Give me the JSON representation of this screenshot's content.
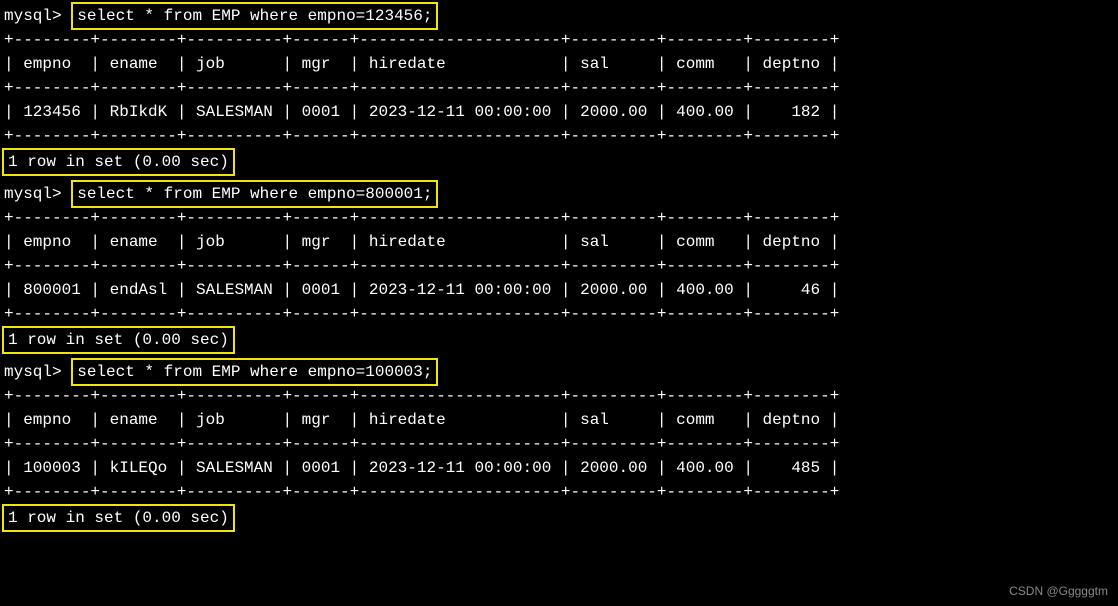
{
  "prompt": "mysql>",
  "queries": [
    {
      "sql": "select * from EMP where empno=123456;",
      "separator": "+--------+--------+----------+------+---------------------+---------+--------+--------+",
      "header": "| empno  | ename  | job      | mgr  | hiredate            | sal     | comm   | deptno |",
      "row": "| 123456 | RbIkdK | SALESMAN | 0001 | 2023-12-11 00:00:00 | 2000.00 | 400.00 |    182 |",
      "status": "1 row in set (0.00 sec)"
    },
    {
      "sql": "select * from EMP where empno=800001;",
      "separator": "+--------+--------+----------+------+---------------------+---------+--------+--------+",
      "header": "| empno  | ename  | job      | mgr  | hiredate            | sal     | comm   | deptno |",
      "row": "| 800001 | endAsl | SALESMAN | 0001 | 2023-12-11 00:00:00 | 2000.00 | 400.00 |     46 |",
      "status": "1 row in set (0.00 sec)"
    },
    {
      "sql": "select * from EMP where empno=100003;",
      "separator": "+--------+--------+----------+------+---------------------+---------+--------+--------+",
      "header": "| empno  | ename  | job      | mgr  | hiredate            | sal     | comm   | deptno |",
      "row": "| 100003 | kILEQo | SALESMAN | 0001 | 2023-12-11 00:00:00 | 2000.00 | 400.00 |    485 |",
      "status": "1 row in set (0.00 sec)"
    }
  ],
  "watermark": "CSDN @Gggggtm",
  "chart_data": {
    "type": "table",
    "columns": [
      "empno",
      "ename",
      "job",
      "mgr",
      "hiredate",
      "sal",
      "comm",
      "deptno"
    ],
    "rows": [
      [
        123456,
        "RbIkdK",
        "SALESMAN",
        "0001",
        "2023-12-11 00:00:00",
        2000.0,
        400.0,
        182
      ],
      [
        800001,
        "endAsl",
        "SALESMAN",
        "0001",
        "2023-12-11 00:00:00",
        2000.0,
        400.0,
        46
      ],
      [
        100003,
        "kILEQo",
        "SALESMAN",
        "0001",
        "2023-12-11 00:00:00",
        2000.0,
        400.0,
        485
      ]
    ]
  }
}
